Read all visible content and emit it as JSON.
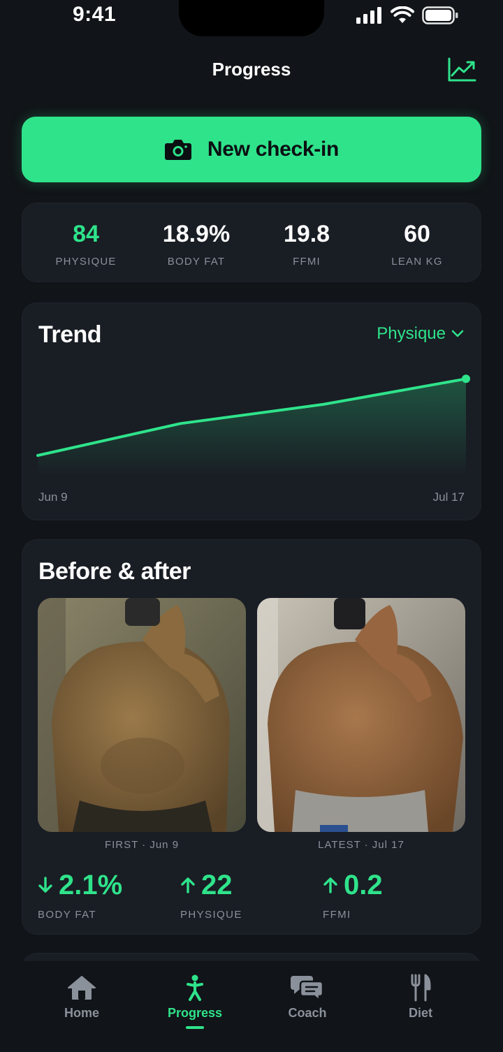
{
  "status_bar": {
    "time": "9:41"
  },
  "header": {
    "title": "Progress",
    "chart_icon": "chart-line-icon"
  },
  "checkin": {
    "label": "New check-in",
    "icon": "camera-icon"
  },
  "stats": [
    {
      "value": "84",
      "label": "PHYSIQUE",
      "highlight": true
    },
    {
      "value": "18.9%",
      "label": "BODY FAT",
      "highlight": false
    },
    {
      "value": "19.8",
      "label": "FFMI",
      "highlight": false
    },
    {
      "value": "60",
      "label": "LEAN KG",
      "highlight": false
    }
  ],
  "trend": {
    "title": "Trend",
    "metric": "Physique",
    "start_label": "Jun 9",
    "end_label": "Jul 17"
  },
  "chart_data": {
    "type": "area",
    "x": [
      "Jun 9",
      "",
      "",
      "Jul 17"
    ],
    "series": [
      {
        "values": [
          62,
          72,
          78,
          86
        ]
      }
    ],
    "ylim": [
      55,
      90
    ],
    "grid": false,
    "color": "#2fe38b"
  },
  "before_after": {
    "title": "Before & after",
    "first_caption": "FIRST · Jun 9",
    "latest_caption": "LATEST · Jul 17",
    "deltas": [
      {
        "direction": "down",
        "value": "2.1%",
        "label": "BODY FAT"
      },
      {
        "direction": "up",
        "value": "22",
        "label": "PHYSIQUE"
      },
      {
        "direction": "up",
        "value": "0.2",
        "label": "FFMI"
      }
    ]
  },
  "tabs": [
    {
      "label": "Home",
      "icon": "home-icon",
      "active": false
    },
    {
      "label": "Progress",
      "icon": "person-icon",
      "active": true
    },
    {
      "label": "Coach",
      "icon": "chat-bubbles-icon",
      "active": false
    },
    {
      "label": "Diet",
      "icon": "fork-knife-icon",
      "active": false
    }
  ],
  "colors": {
    "accent": "#2fe38b",
    "background": "#111418",
    "card": "#191d24",
    "muted": "#8b919b"
  }
}
